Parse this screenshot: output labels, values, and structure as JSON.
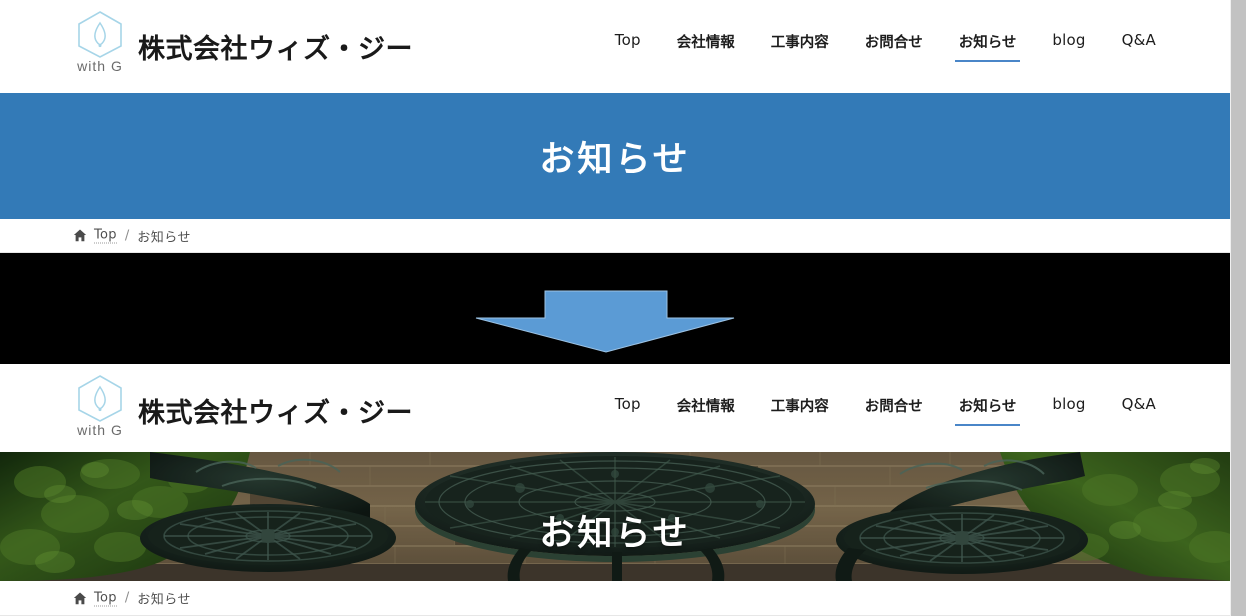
{
  "site": {
    "brand_name": "株式会社ウィズ・ジー",
    "logo_sub": "with G",
    "logo_icon": "hexagon-leaf-logo-icon"
  },
  "nav": {
    "items": [
      {
        "label": "Top",
        "type": "latin",
        "active": false
      },
      {
        "label": "会社情報",
        "type": "jp",
        "active": false
      },
      {
        "label": "工事内容",
        "type": "jp",
        "active": false
      },
      {
        "label": "お問合せ",
        "type": "jp",
        "active": false
      },
      {
        "label": "お知らせ",
        "type": "jp",
        "active": true
      },
      {
        "label": "blog",
        "type": "latin",
        "active": false
      },
      {
        "label": "Q&A",
        "type": "latin",
        "active": false
      }
    ]
  },
  "banner_flat": {
    "title": "お知らせ",
    "background_color": "#337ab7"
  },
  "banner_photo": {
    "title": "お知らせ",
    "image_description": "garden-patio-photo"
  },
  "breadcrumb": {
    "home_icon": "home-icon",
    "link_label": "Top",
    "separator": "/",
    "current_label": "お知らせ"
  },
  "arrow_band": {
    "icon": "down-arrow-icon",
    "arrow_color": "#5b9bd5",
    "background_color": "#000000"
  },
  "colors": {
    "accent_blue": "#337ab7",
    "nav_underline": "#4a86c8",
    "logo_blue": "#a6d5e8",
    "scrollbar": "#c2c2c2"
  },
  "scrollbar": {
    "name": "vertical-scrollbar"
  }
}
